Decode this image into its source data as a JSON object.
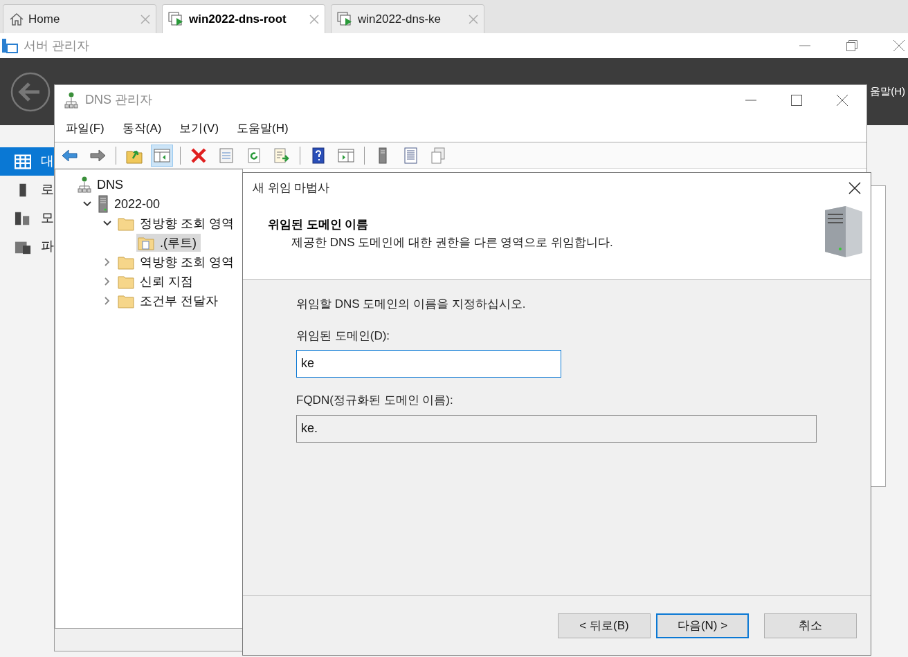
{
  "tabs": [
    {
      "label": "Home",
      "kind": "home",
      "selected": false
    },
    {
      "label": "win2022-dns-root",
      "kind": "vm",
      "selected": true
    },
    {
      "label": "win2022-dns-ke",
      "kind": "vm",
      "selected": false
    }
  ],
  "server_manager": {
    "title": "서버 관리자",
    "header_menu_fragment": "움말(H)",
    "sidebar": [
      {
        "label": "대",
        "kind": "dashboard",
        "selected": true
      },
      {
        "label": "로",
        "kind": "local",
        "selected": false
      },
      {
        "label": "모",
        "kind": "all",
        "selected": false
      },
      {
        "label": "파",
        "kind": "files",
        "selected": false
      }
    ]
  },
  "dns_manager": {
    "title": "DNS 관리자",
    "menu": [
      "파일(F)",
      "동작(A)",
      "보기(V)",
      "도움말(H)"
    ],
    "toolbar": [
      {
        "kind": "back",
        "pressed": false
      },
      {
        "kind": "forward",
        "pressed": false
      },
      {
        "kind": "separator"
      },
      {
        "kind": "up",
        "pressed": false
      },
      {
        "kind": "tree",
        "pressed": true
      },
      {
        "kind": "separator"
      },
      {
        "kind": "delete",
        "pressed": false
      },
      {
        "kind": "properties",
        "pressed": false
      },
      {
        "kind": "refresh",
        "pressed": false
      },
      {
        "kind": "export",
        "pressed": false
      },
      {
        "kind": "separator"
      },
      {
        "kind": "help",
        "pressed": false
      },
      {
        "kind": "action",
        "pressed": false
      },
      {
        "kind": "separator"
      },
      {
        "kind": "server",
        "pressed": false
      },
      {
        "kind": "list",
        "pressed": false
      },
      {
        "kind": "copy",
        "pressed": false
      }
    ],
    "tree": [
      {
        "label": "DNS",
        "kind": "dns",
        "selected": false,
        "children": [
          {
            "label": "2022-00",
            "kind": "server",
            "expanded": true,
            "selected": false,
            "children": [
              {
                "label": "정방향 조회 영역",
                "kind": "folder",
                "expanded": true,
                "selected": false,
                "children": [
                  {
                    "label": ".(루트)",
                    "kind": "zone",
                    "selected": true
                  }
                ]
              },
              {
                "label": "역방향 조회 영역",
                "kind": "folder",
                "expanded": false,
                "selected": false
              },
              {
                "label": "신뢰 지점",
                "kind": "folder",
                "expanded": false,
                "selected": false
              },
              {
                "label": "조건부 전달자",
                "kind": "folder",
                "expanded": false,
                "selected": false
              }
            ]
          }
        ]
      }
    ]
  },
  "wizard": {
    "title": "새 위임 마법사",
    "heading": "위임된 도메인 이름",
    "subtitle": "제공한 DNS 도메인에 대한 권한을 다른 영역으로 위임합니다.",
    "prompt": "위임할 DNS 도메인의 이름을 지정하십시오.",
    "fields": [
      {
        "label": "위임된 도메인(D):",
        "value": "ke",
        "disabled": false
      },
      {
        "label": "FQDN(정규화된 도메인 이름):",
        "value": "ke.",
        "disabled": true
      }
    ],
    "buttons": [
      {
        "label": "< 뒤로(B)",
        "default": false
      },
      {
        "label": "다음(N) >",
        "default": true
      },
      {
        "label": "취소",
        "default": false
      }
    ]
  }
}
